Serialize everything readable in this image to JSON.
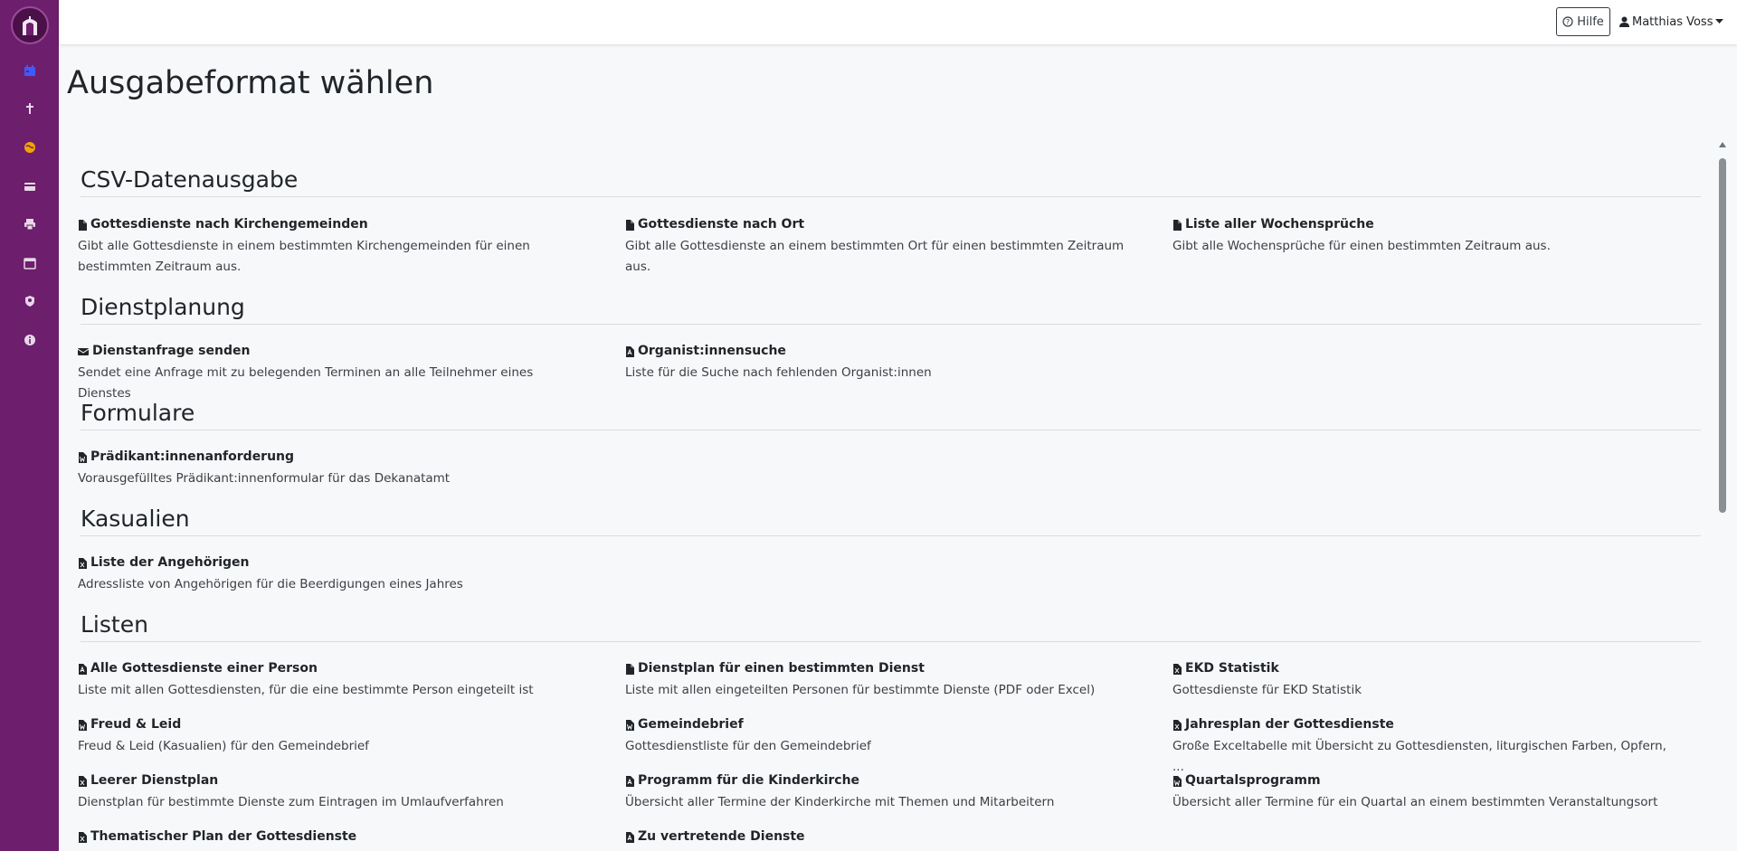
{
  "header": {
    "help_label": "Hilfe",
    "user_name": "Matthias Voss"
  },
  "page": {
    "title": "Ausgabeformat wählen"
  },
  "sidebar": {
    "items": [
      {
        "name": "calendar-icon",
        "color": "#3d5bff"
      },
      {
        "name": "cross-icon",
        "color": "#e8d7e8"
      },
      {
        "name": "globe-icon",
        "color": "#f0a500"
      },
      {
        "name": "card-icon",
        "color": "#e8d7e8"
      },
      {
        "name": "printer-icon",
        "color": "#e8d7e8"
      },
      {
        "name": "calendar-grid-icon",
        "color": "#e8d7e8"
      },
      {
        "name": "user-shield-icon",
        "color": "#e8d7e8"
      },
      {
        "name": "info-icon",
        "color": "#e8d7e8"
      }
    ]
  },
  "sections": [
    {
      "title": "CSV-Datenausgabe",
      "items": [
        {
          "icon": "file-icon",
          "title": "Gottesdienste nach Kirchengemeinden",
          "desc": "Gibt alle Gottesdienste in einem bestimmten Kirchengemeinden für einen bestimmten Zeitraum aus."
        },
        {
          "icon": "file-icon",
          "title": "Gottesdienste nach Ort",
          "desc": "Gibt alle Gottesdienste an einem bestimmten Ort für einen bestimmten Zeitraum aus."
        },
        {
          "icon": "file-icon",
          "title": "Liste aller Wochensprüche",
          "desc": "Gibt alle Wochensprüche für einen bestimmten Zeitraum aus."
        }
      ]
    },
    {
      "title": "Dienstplanung",
      "items": [
        {
          "icon": "envelope-icon",
          "title": "Dienstanfrage senden",
          "desc": "Sendet eine Anfrage mit zu belegenden Terminen an alle Teilnehmer eines Dienstes"
        },
        {
          "icon": "file-pdf-icon",
          "title": "Organist:innensuche",
          "desc": "Liste für die Suche nach fehlenden Organist:innen"
        }
      ]
    },
    {
      "title": "Formulare",
      "items": [
        {
          "icon": "file-word-icon",
          "title": "Prädikant:innenanforderung",
          "desc": "Vorausgefülltes Prädikant:innenformular für das Dekanatamt"
        }
      ]
    },
    {
      "title": "Kasualien",
      "items": [
        {
          "icon": "file-excel-icon",
          "title": "Liste der Angehörigen",
          "desc": "Adressliste von Angehörigen für die Beerdigungen eines Jahres"
        }
      ]
    },
    {
      "title": "Listen",
      "items": [
        {
          "icon": "file-pdf-icon",
          "title": "Alle Gottesdienste einer Person",
          "desc": "Liste mit allen Gottesdiensten, für die eine bestimmte Person eingeteilt ist"
        },
        {
          "icon": "file-icon",
          "title": "Dienstplan für einen bestimmten Dienst",
          "desc": "Liste mit allen eingeteilten Personen für bestimmte Dienste (PDF oder Excel)"
        },
        {
          "icon": "file-excel-icon",
          "title": "EKD Statistik",
          "desc": "Gottesdienste für EKD Statistik"
        },
        {
          "icon": "file-word-icon",
          "title": "Freud & Leid",
          "desc": "Freud & Leid (Kasualien) für den Gemeindebrief"
        },
        {
          "icon": "file-word-icon",
          "title": "Gemeindebrief",
          "desc": "Gottesdienstliste für den Gemeindebrief"
        },
        {
          "icon": "file-excel-icon",
          "title": "Jahresplan der Gottesdienste",
          "desc": "Große Exceltabelle mit Übersicht zu Gottesdiensten, liturgischen Farben, Opfern, ..."
        },
        {
          "icon": "file-excel-icon",
          "title": "Leerer Dienstplan",
          "desc": "Dienstplan für bestimmte Dienste zum Eintragen im Umlaufverfahren"
        },
        {
          "icon": "file-pdf-icon",
          "title": "Programm für die Kinderkirche",
          "desc": "Übersicht aller Termine der Kinderkirche mit Themen und Mitarbeitern"
        },
        {
          "icon": "file-word-icon",
          "title": "Quartalsprogramm",
          "desc": "Übersicht aller Termine für ein Quartal an einem bestimmten Veranstaltungsort"
        },
        {
          "icon": "file-excel-icon",
          "title": "Thematischer Plan der Gottesdienste",
          "desc": ""
        },
        {
          "icon": "file-pdf-icon",
          "title": "Zu vertretende Dienste",
          "desc": ""
        }
      ]
    }
  ]
}
